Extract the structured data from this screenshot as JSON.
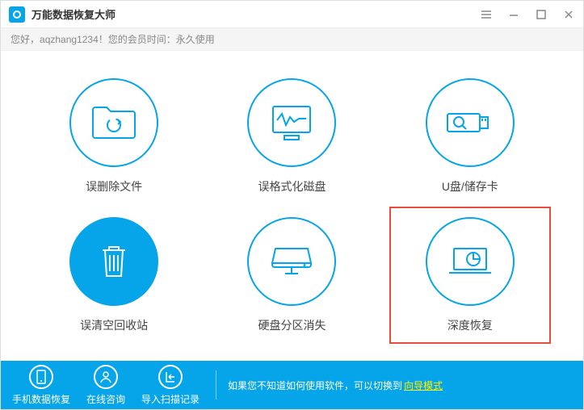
{
  "titlebar": {
    "title": "万能数据恢复大师"
  },
  "greeting": {
    "prefix": "您好，",
    "username": "aqzhang1234",
    "suffix": "！您的会员时间：",
    "status": "永久使用"
  },
  "options": [
    {
      "id": "deleted-files",
      "label": "误删除文件",
      "icon": "folder-refresh",
      "highlight": false
    },
    {
      "id": "formatted-disk",
      "label": "误格式化磁盘",
      "icon": "monitor-wave",
      "highlight": false
    },
    {
      "id": "usb-sd",
      "label": "U盘/储存卡",
      "icon": "usb-search",
      "highlight": false
    },
    {
      "id": "recycle-bin",
      "label": "误清空回收站",
      "icon": "trash",
      "highlight": false
    },
    {
      "id": "partition-lost",
      "label": "硬盘分区消失",
      "icon": "drive",
      "highlight": false
    },
    {
      "id": "deep-recovery",
      "label": "深度恢复",
      "icon": "laptop-scan",
      "highlight": true
    }
  ],
  "footer": {
    "items": [
      {
        "id": "phone-recovery",
        "label": "手机数据恢复",
        "icon": "phone"
      },
      {
        "id": "online-chat",
        "label": "在线咨询",
        "icon": "user"
      },
      {
        "id": "import-scan",
        "label": "导入扫描记录",
        "icon": "import"
      }
    ],
    "hint_text": "如果您不知道如何使用软件，可以切换到",
    "hint_link": "向导模式"
  }
}
